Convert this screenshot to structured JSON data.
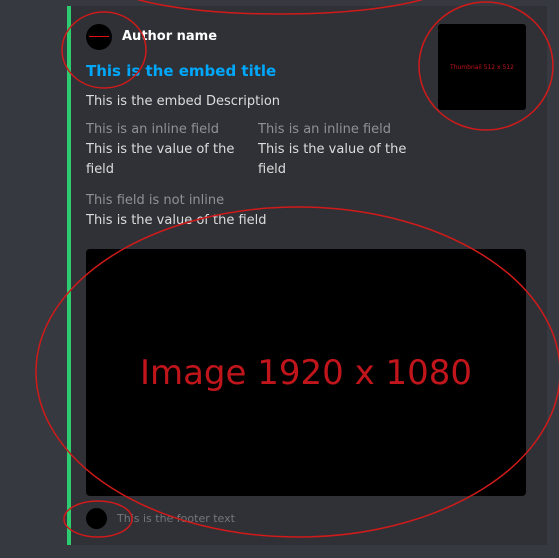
{
  "colors": {
    "background": "#36393f",
    "embed_background": "#2f3136",
    "embed_accent": "#2ecc71",
    "title": "#00a8fc",
    "annotation": "#d11a1a"
  },
  "embed": {
    "author": {
      "name": "Author name",
      "icon": "author-avatar-icon"
    },
    "title": "This is the embed title",
    "description": "This is the embed Description",
    "fields": [
      {
        "name": "This is an inline field",
        "value": "This is the value of the field",
        "inline": true
      },
      {
        "name": "This is an inline field",
        "value": "This is the value of the field",
        "inline": true
      },
      {
        "name": "This field is not inline",
        "value": "This is the value of the field",
        "inline": false
      }
    ],
    "thumbnail": {
      "label": "Thumbnail 512 x 512"
    },
    "image": {
      "label": "Image 1920 x 1080"
    },
    "footer": {
      "text": "This is the footer text",
      "icon": "footer-avatar-icon"
    }
  }
}
